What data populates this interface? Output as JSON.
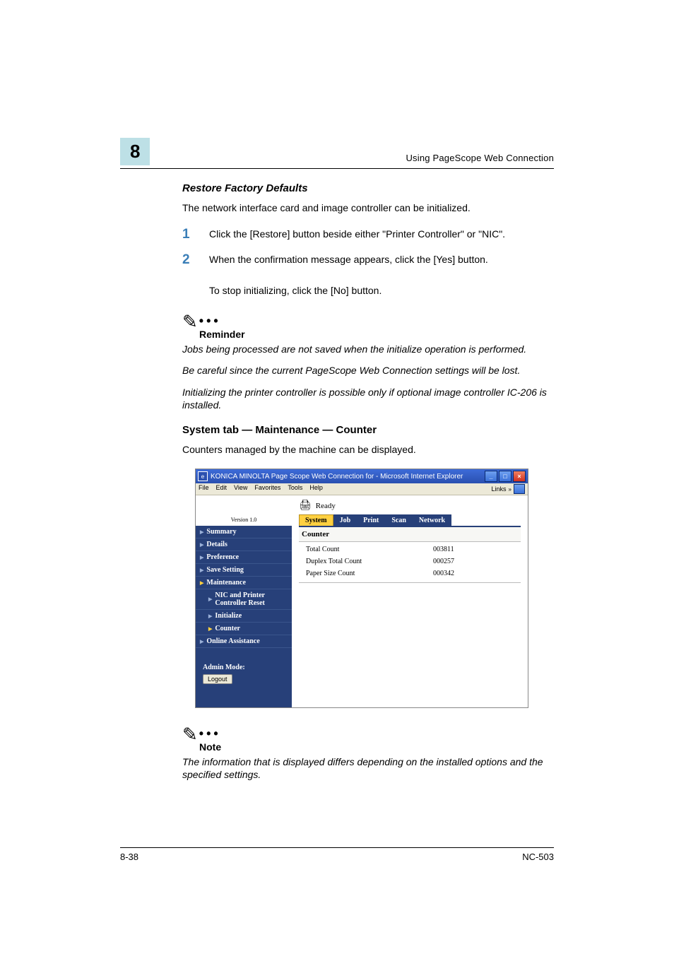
{
  "header": {
    "chapter_number": "8",
    "running_title": "Using PageScope Web Connection"
  },
  "sections": {
    "restore": {
      "title": "Restore Factory Defaults",
      "intro": "The network interface card and image controller can be initialized.",
      "steps": [
        "Click the [Restore] button beside either \"Printer Controller\" or \"NIC\".",
        "When the confirmation message appears, click the [Yes] button."
      ],
      "step2_extra": "To stop initializing, click the [No] button."
    },
    "reminder": {
      "label": "Reminder",
      "p1": "Jobs being processed are not saved when the initialize operation is performed.",
      "p2": "Be careful since the current PageScope Web Connection settings will be lost.",
      "p3": "Initializing the printer controller is possible only if optional image controller IC-206 is installed."
    },
    "counter": {
      "title": "System tab — Maintenance — Counter",
      "intro": "Counters managed by the machine can be displayed."
    },
    "note": {
      "label": "Note",
      "p1": "The information that is displayed differs depending on the installed options and the specified settings."
    }
  },
  "screenshot": {
    "window_title": "KONICA MINOLTA Page Scope Web Connection for      - Microsoft Internet Explorer",
    "menu": [
      "File",
      "Edit",
      "View",
      "Favorites",
      "Tools",
      "Help"
    ],
    "links_label": "Links",
    "version": "Version 1.0",
    "status_text": "Ready",
    "tabs": [
      "System",
      "Job",
      "Print",
      "Scan",
      "Network"
    ],
    "active_tab": "System",
    "sidebar": {
      "items": [
        "Summary",
        "Details",
        "Preference",
        "Save Setting",
        "Maintenance",
        "NIC and Printer Controller Reset",
        "Initialize",
        "Counter",
        "Online Assistance"
      ],
      "admin_label": "Admin Mode:",
      "logout_label": "Logout"
    },
    "panel": {
      "title": "Counter",
      "rows": [
        {
          "label": "Total Count",
          "value": "003811"
        },
        {
          "label": "Duplex Total Count",
          "value": "000257"
        },
        {
          "label": "Paper Size Count",
          "value": "000342"
        }
      ]
    }
  },
  "footer": {
    "left": "8-38",
    "right": "NC-503"
  }
}
